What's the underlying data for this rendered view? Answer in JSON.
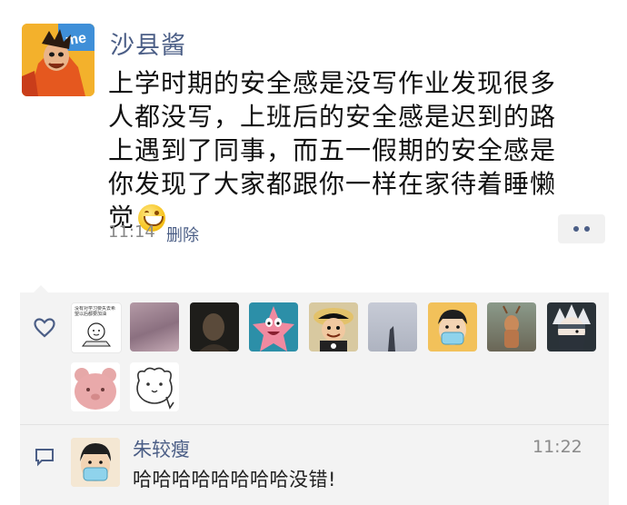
{
  "post": {
    "author": "沙县酱",
    "text": "上学时期的安全感是没写作业发现很多人都没写，上班后的安全感是迟到的路上遇到了同事，而五一假期的安全感是你发现了大家都跟你一样在家待着睡懒觉",
    "time": "11:14",
    "delete_label": "删除",
    "emoji_icon": "grinning-face-icon",
    "more_icon": "more-dots-icon"
  },
  "likes": {
    "icon": "heart-icon",
    "avatars": [
      "sticker-avatar",
      "blurred-photo-avatar",
      "dark-portrait-avatar",
      "patrick-star-avatar",
      "luffy-avatar",
      "grey-photo-avatar",
      "masked-man-avatar",
      "deer-photo-avatar",
      "kakashi-avatar",
      "pink-bear-avatar",
      "outline-bear-avatar"
    ],
    "sticker_caption": "没有对学习要失去希望以后都要加油"
  },
  "comments": [
    {
      "author": "朱较瘦",
      "time": "11:22",
      "text": "哈哈哈哈哈哈哈哈没错!",
      "icon": "comment-icon"
    }
  ],
  "colors": {
    "link_blue": "#4b5e86",
    "panel_bg": "#f3f3f3",
    "time_grey": "#8a8a8a"
  }
}
